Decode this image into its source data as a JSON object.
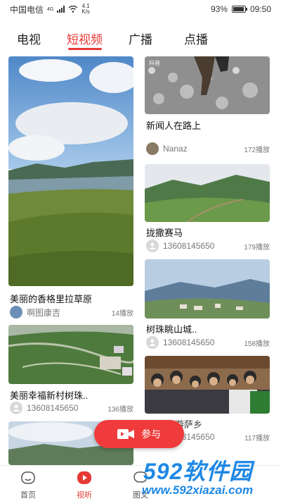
{
  "status_bar": {
    "carrier": "中国电信",
    "network_badge": "4G",
    "speed_value": "4.1",
    "speed_unit": "K/s",
    "battery": "93%",
    "battery_level": 0.93,
    "time": "09:50"
  },
  "tabs": [
    {
      "label": "电视",
      "active": false
    },
    {
      "label": "短视频",
      "active": true
    },
    {
      "label": "广播",
      "active": false
    },
    {
      "label": "点播",
      "active": false
    }
  ],
  "left_column": [
    {
      "title": "美丽的香格里拉草原",
      "author": "啊图康吉",
      "plays": "14播放",
      "thumb": "grassland-lake-sky"
    },
    {
      "title": "美丽幸福新村树珠..",
      "author": "13608145650",
      "plays": "136播放",
      "thumb": "village-aerial"
    },
    {
      "title": "",
      "author": "",
      "plays": "",
      "thumb": "mountain-sky"
    }
  ],
  "right_column": [
    {
      "title": "新闻人在路上",
      "author": "Nanaz",
      "plays": "172播放",
      "thumb": "rocky-path",
      "overlay_label": "抖音"
    },
    {
      "title": "拢撒赛马",
      "author": "13608145650",
      "plays": "179播放",
      "thumb": "mountain-meadow"
    },
    {
      "title": "树珠眺山城..",
      "author": "13608145650",
      "plays": "158播放",
      "thumb": "valley-town"
    },
    {
      "title": "",
      "author": "13608145650",
      "plays": "117播放",
      "thumb": "group-photo",
      "partial_title": "和游萨乡"
    }
  ],
  "float_button": {
    "label": "参与",
    "icon": "video-camera-icon"
  },
  "bottom_nav": [
    {
      "label": "首页",
      "icon": "home-icon",
      "active": false
    },
    {
      "label": "视听",
      "icon": "play-icon",
      "active": true
    },
    {
      "label": "图文",
      "icon": "chat-icon",
      "active": false
    }
  ],
  "watermark": {
    "brand": "592软件园",
    "url": "www.592xiazai.com"
  },
  "colors": {
    "accent": "#e53935",
    "button": "#ef3b3b",
    "watermark": "#1e88e5"
  }
}
